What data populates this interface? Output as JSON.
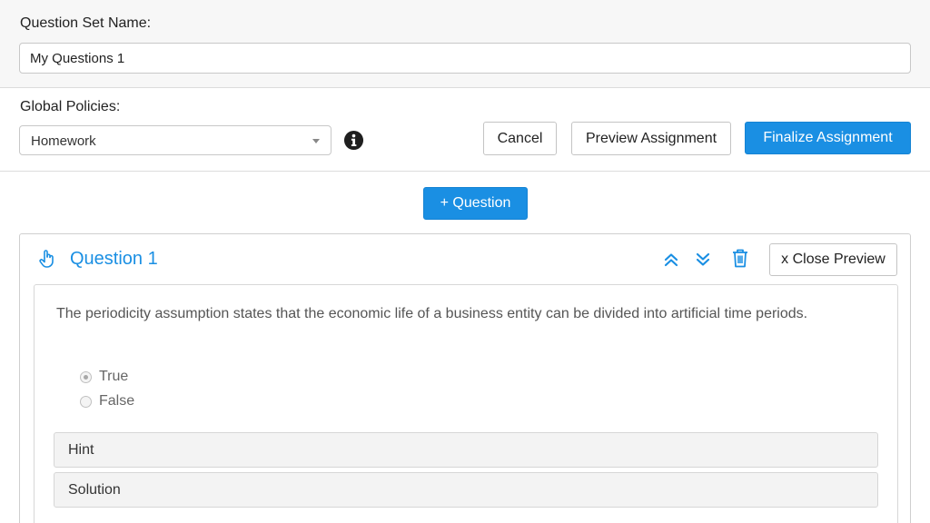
{
  "set_name": {
    "label": "Question Set Name:",
    "value": "My Questions 1"
  },
  "policies": {
    "label": "Global Policies:",
    "selected": "Homework",
    "info_icon": "info-circle-icon"
  },
  "actions": {
    "cancel": "Cancel",
    "preview": "Preview Assignment",
    "finalize": "Finalize Assignment"
  },
  "add_question": "+ Question",
  "question": {
    "title": "Question 1",
    "close_preview": "x Close Preview",
    "text": "The periodicity assumption states that the economic life of a business entity can be divided into artificial time periods.",
    "options": [
      {
        "label": "True",
        "selected": true
      },
      {
        "label": "False",
        "selected": false
      }
    ],
    "hint_label": "Hint",
    "solution_label": "Solution",
    "icons": {
      "drag": "hand-pointer-icon",
      "up": "chevron-double-up-icon",
      "down": "chevron-double-down-icon",
      "delete": "trash-icon"
    }
  },
  "colors": {
    "accent": "#1a8fe3",
    "top_background": "#f7f7f7"
  }
}
